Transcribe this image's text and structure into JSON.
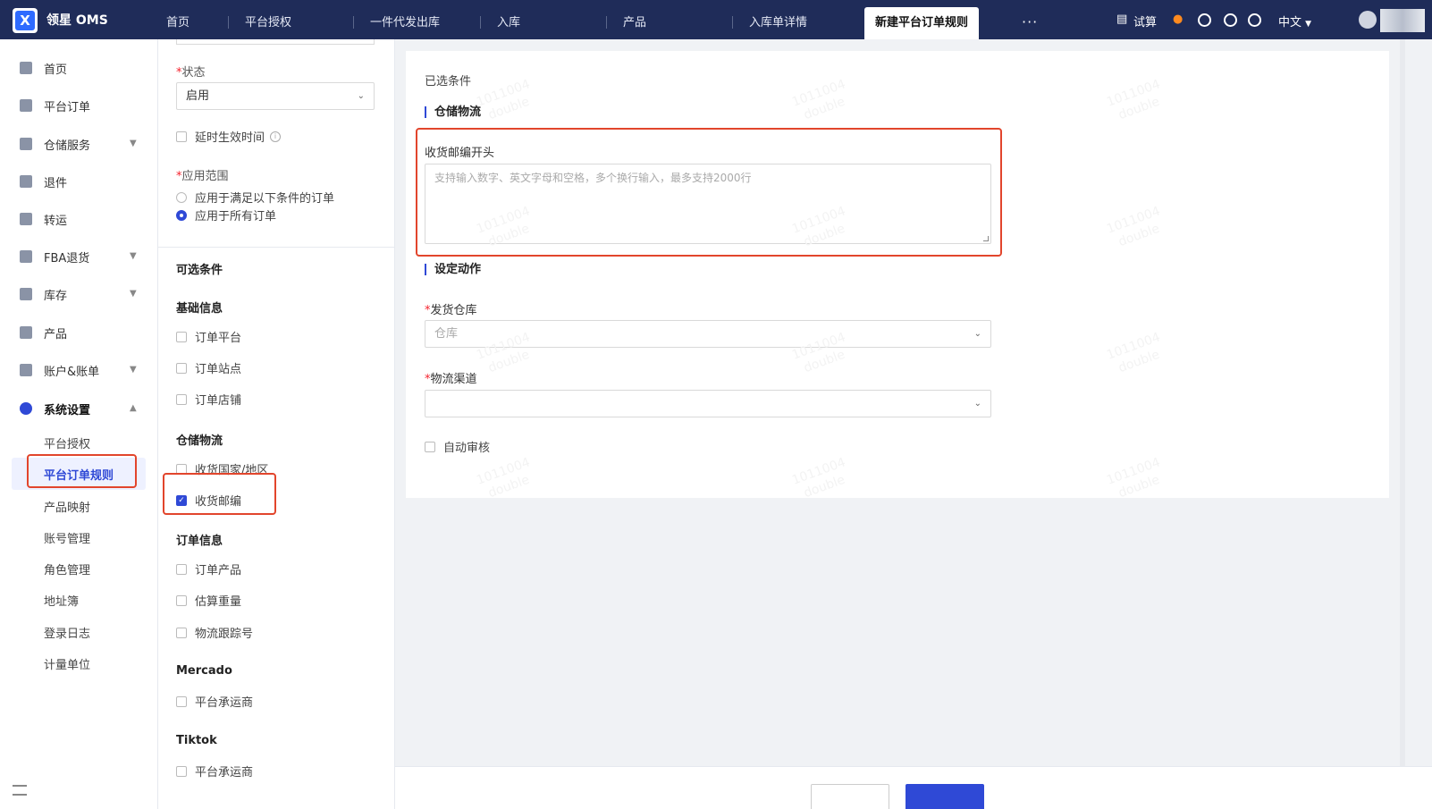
{
  "topbar": {
    "brand": "领星 OMS",
    "tabs": [
      {
        "label": "首页"
      },
      {
        "label": "平台授权"
      },
      {
        "label": "一件代发出库"
      },
      {
        "label": "入库"
      },
      {
        "label": "产品"
      },
      {
        "label": "入库单详情"
      },
      {
        "label": "新建平台订单规则"
      }
    ],
    "more_label": "···",
    "trial_label": "试算",
    "language_label": "中文"
  },
  "sidebar": {
    "items": [
      {
        "label": "首页",
        "icon": "home-icon"
      },
      {
        "label": "平台订单",
        "icon": "order-icon"
      },
      {
        "label": "仓储服务",
        "icon": "warehouse-icon"
      },
      {
        "label": "退件",
        "icon": "return-icon"
      },
      {
        "label": "转运",
        "icon": "transfer-icon"
      },
      {
        "label": "FBA退货",
        "icon": "amazon-icon"
      },
      {
        "label": "库存",
        "icon": "inventory-icon"
      },
      {
        "label": "产品",
        "icon": "product-icon"
      },
      {
        "label": "账户&账单",
        "icon": "account-icon"
      },
      {
        "label": "系统设置",
        "icon": "settings-icon"
      }
    ],
    "sub_items": [
      {
        "label": "平台授权"
      },
      {
        "label": "平台订单规则"
      },
      {
        "label": "产品映射"
      },
      {
        "label": "账号管理"
      },
      {
        "label": "角色管理"
      },
      {
        "label": "地址簿"
      },
      {
        "label": "登录日志"
      },
      {
        "label": "计量单位"
      }
    ]
  },
  "config": {
    "status_label": "状态",
    "status_value": "启用",
    "delay_label": "延时生效时间",
    "scope_label": "应用范围",
    "scope_options": [
      {
        "label": "应用于满足以下条件的订单",
        "selected": false
      },
      {
        "label": "应用于所有订单",
        "selected": true
      }
    ]
  },
  "optional": {
    "title": "可选条件",
    "groups": [
      {
        "title": "基础信息",
        "items": [
          {
            "label": "订单平台",
            "checked": false
          },
          {
            "label": "订单站点",
            "checked": false
          },
          {
            "label": "订单店铺",
            "checked": false
          }
        ]
      },
      {
        "title": "仓储物流",
        "items": [
          {
            "label": "收货国家/地区",
            "checked": false
          },
          {
            "label": "收货邮编",
            "checked": true
          }
        ]
      },
      {
        "title": "订单信息",
        "items": [
          {
            "label": "订单产品",
            "checked": false
          },
          {
            "label": "估算重量",
            "checked": false
          },
          {
            "label": "物流跟踪号",
            "checked": false
          }
        ]
      },
      {
        "title": "Mercado",
        "items": [
          {
            "label": "平台承运商",
            "checked": false
          }
        ]
      },
      {
        "title": "Tiktok",
        "items": [
          {
            "label": "平台承运商",
            "checked": false
          }
        ]
      }
    ]
  },
  "selected": {
    "title": "已选条件",
    "section_title": "仓储物流",
    "zip_label": "收货邮编开头",
    "zip_placeholder": "支持输入数字、英文字母和空格，多个换行输入，最多支持2000行",
    "action_title": "设定动作",
    "warehouse_label": "发货仓库",
    "warehouse_placeholder": "仓库",
    "channel_label": "物流渠道",
    "channel_value": "",
    "auto_review_label": "自动审核",
    "auto_review_checked": false
  },
  "watermark": {
    "line1": "1011004",
    "line2": "double"
  },
  "colors": {
    "accent": "#2f49d6",
    "topbar": "#1f2c59",
    "highlight": "#e2452c",
    "required": "#f5222d"
  }
}
